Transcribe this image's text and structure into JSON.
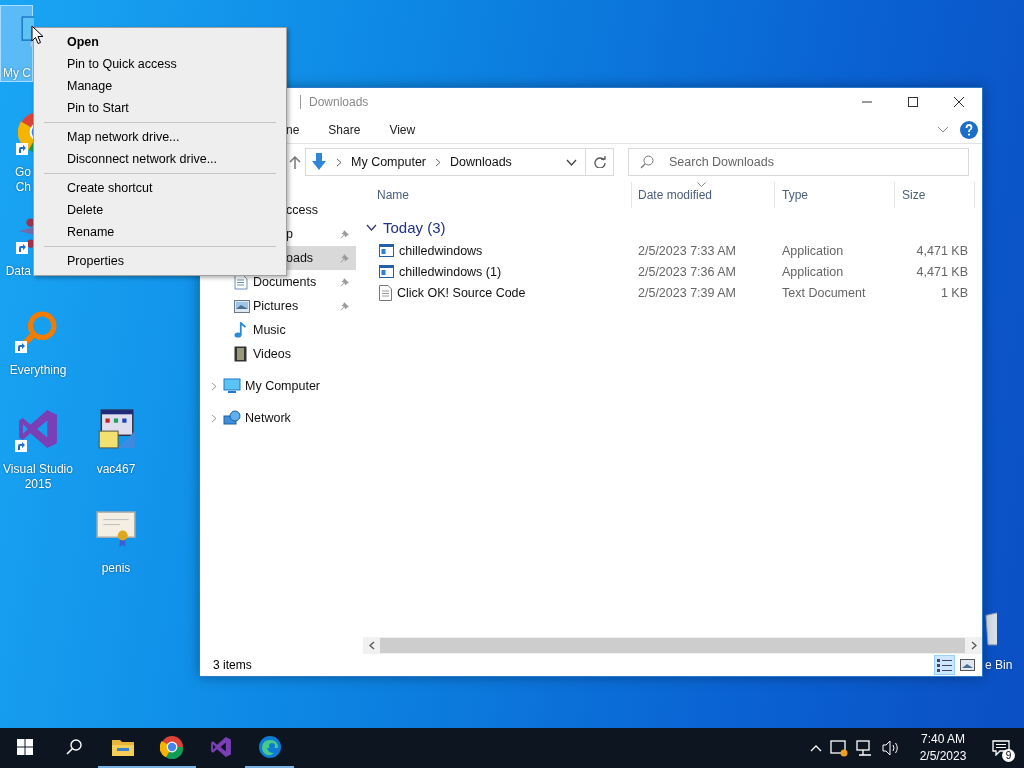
{
  "desktop": {
    "icons": [
      {
        "kind": "computer",
        "label": "My C",
        "selected": true,
        "shortcut": false
      },
      {
        "kind": "chrome",
        "label": "Go\nCh",
        "selected": false,
        "shortcut": true
      },
      {
        "kind": "datawindow",
        "label": "Data",
        "selected": false,
        "shortcut": true
      },
      {
        "kind": "everything",
        "label": "Everything",
        "selected": false,
        "shortcut": true
      },
      {
        "kind": "visualstudio",
        "label": "Visual Studio\n2015",
        "selected": false,
        "shortcut": true
      },
      {
        "kind": "vac",
        "label": "vac467",
        "selected": false,
        "shortcut": false
      },
      {
        "kind": "certificate",
        "label": "penis",
        "selected": false,
        "shortcut": false
      },
      {
        "kind": "recycle",
        "label": "e Bin",
        "selected": false,
        "shortcut": false
      }
    ]
  },
  "context_menu": {
    "items": [
      {
        "kind": "item",
        "label": "Open",
        "default": true
      },
      {
        "kind": "item",
        "label": "Pin to Quick access",
        "default": false
      },
      {
        "kind": "item",
        "label": "Manage",
        "default": false
      },
      {
        "kind": "item",
        "label": "Pin to Start",
        "default": false
      },
      {
        "kind": "separator"
      },
      {
        "kind": "item",
        "label": "Map network drive...",
        "default": false
      },
      {
        "kind": "item",
        "label": "Disconnect network drive...",
        "default": false
      },
      {
        "kind": "separator"
      },
      {
        "kind": "item",
        "label": "Create shortcut",
        "default": false
      },
      {
        "kind": "item",
        "label": "Delete",
        "default": false
      },
      {
        "kind": "item",
        "label": "Rename",
        "default": false
      },
      {
        "kind": "separator"
      },
      {
        "kind": "item",
        "label": "Properties",
        "default": false
      }
    ]
  },
  "explorer": {
    "title": "Downloads",
    "ribbon_tabs": [
      {
        "label": "ne",
        "selected": false
      },
      {
        "label": "Share",
        "selected": false
      },
      {
        "label": "View",
        "selected": false
      }
    ],
    "address": {
      "crumbs": [
        "My Computer",
        "Downloads"
      ]
    },
    "search": {
      "placeholder": "Search Downloads"
    },
    "nav": {
      "items": [
        {
          "kind": "cut",
          "label": "ccess",
          "selected": false,
          "pinned": false,
          "children": [
            {
              "kind": "cut",
              "label": "p",
              "selected": false,
              "pinned": true
            },
            {
              "kind": "cut",
              "label": "oads",
              "selected": true,
              "pinned": true
            },
            {
              "kind": "documents",
              "label": "Documents",
              "selected": false,
              "pinned": true
            },
            {
              "kind": "pictures",
              "label": "Pictures",
              "selected": false,
              "pinned": true
            },
            {
              "kind": "music",
              "label": "Music",
              "selected": false,
              "pinned": false
            },
            {
              "kind": "videos",
              "label": "Videos",
              "selected": false,
              "pinned": false
            }
          ]
        },
        {
          "kind": "computer",
          "label": "My Computer",
          "selected": false,
          "pinned": false,
          "expanded": false
        },
        {
          "kind": "network",
          "label": "Network",
          "selected": false,
          "pinned": false,
          "expanded": false
        }
      ]
    },
    "columns": [
      {
        "label": "Name",
        "sorted": false
      },
      {
        "label": "Date modified",
        "sorted": true
      },
      {
        "label": "Type",
        "sorted": false
      },
      {
        "label": "Size",
        "sorted": false
      }
    ],
    "groups": [
      {
        "label": "Today (3)",
        "expanded": true,
        "rows": [
          {
            "kind": "app",
            "name": "chilledwindows",
            "date": "2/5/2023 7:33 AM",
            "type": "Application",
            "size": "4,471 KB"
          },
          {
            "kind": "app",
            "name": "chilledwindows (1)",
            "date": "2/5/2023 7:36 AM",
            "type": "Application",
            "size": "4,471 KB"
          },
          {
            "kind": "text",
            "name": "Click OK! Source Code",
            "date": "2/5/2023 7:39 AM",
            "type": "Text Document",
            "size": "1 KB"
          }
        ]
      }
    ],
    "status": "3 items",
    "views": [
      {
        "kind": "details",
        "selected": true
      },
      {
        "kind": "large",
        "selected": false
      }
    ]
  },
  "taskbar": {
    "buttons": [
      {
        "kind": "start",
        "running": false
      },
      {
        "kind": "search",
        "running": false
      },
      {
        "kind": "explorer",
        "running": true
      },
      {
        "kind": "chrome",
        "running": true
      },
      {
        "kind": "visualstudio",
        "running": false
      },
      {
        "kind": "edge",
        "running": true
      }
    ],
    "time": "7:40 AM",
    "date": "2/5/2023",
    "notifications": "9"
  }
}
